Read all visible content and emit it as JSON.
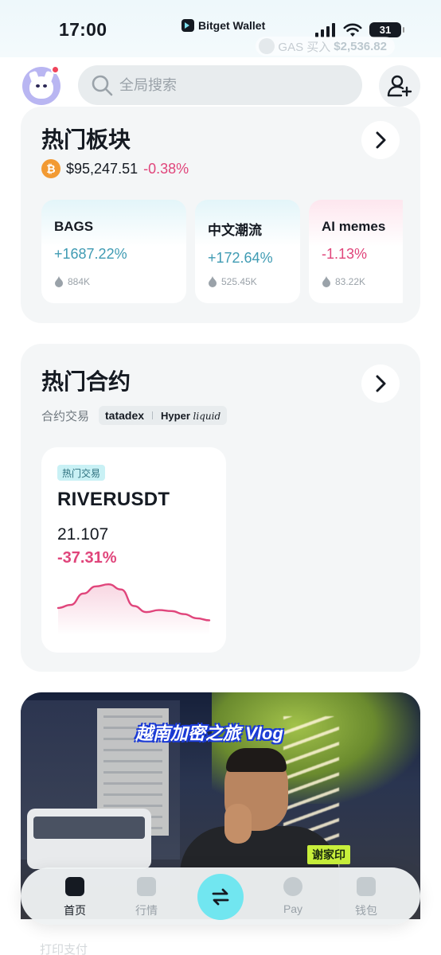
{
  "status_bar": {
    "time": "17:00",
    "app_name": "Bitget Wallet",
    "battery": "31"
  },
  "ghost_gas": {
    "label": "GAS 买入",
    "amount": "$2,536.82"
  },
  "header": {
    "search_placeholder": "全局搜索"
  },
  "hot_sectors": {
    "title": "热门板块",
    "btc_price": "$95,247.51",
    "btc_change": "-0.38%",
    "items": [
      {
        "name": "BAGS",
        "change": "+1687.22%",
        "volume": "884K",
        "trend": "up"
      },
      {
        "name": "中文潮流",
        "change": "+172.64%",
        "volume": "525.45K",
        "trend": "up"
      },
      {
        "name": "AI memes",
        "change": "-1.13%",
        "volume": "83.22K",
        "trend": "down"
      }
    ]
  },
  "hot_futures": {
    "title": "热门合约",
    "subtitle": "合约交易",
    "platform_1": "tatadex",
    "platform_2_a": "Hyper",
    "platform_2_b": "liquid",
    "contract": {
      "tag": "热门交易",
      "pair": "RIVERUSDT",
      "price": "21.107",
      "change": "-37.31%",
      "sparkline": [
        24,
        27,
        38,
        45,
        47,
        42,
        26,
        20,
        22,
        21,
        18,
        14,
        12
      ]
    }
  },
  "banner": {
    "title": "越南加密之旅 Vlog",
    "caption": "谢家印"
  },
  "tabbar": {
    "items": [
      {
        "label": "首页",
        "active": true
      },
      {
        "label": "行情",
        "active": false
      },
      {
        "label": "Pay",
        "active": false
      },
      {
        "label": "钱包",
        "active": false
      }
    ]
  },
  "ghost_bottom": "打印支付",
  "colors": {
    "accent": "#71e6f0",
    "negative": "#e0457b",
    "positive": "#3f9bb3",
    "card_bg": "#f4f6f7"
  }
}
